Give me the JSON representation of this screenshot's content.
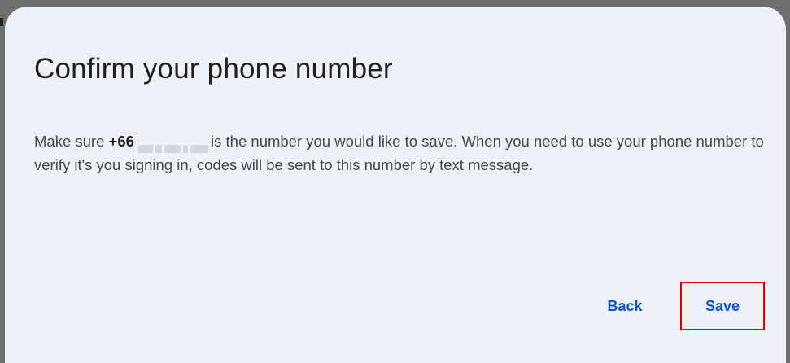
{
  "dialog": {
    "title": "Confirm your phone number",
    "body_prefix": "Make sure ",
    "phone_prefix": "+66",
    "body_suffix": "is the number you would like to save. When you need to use your phone number to verify it's you signing in, codes will be sent to this number by text message.",
    "actions": {
      "back_label": "Back",
      "save_label": "Save"
    }
  },
  "colors": {
    "dialog_bg": "#eef1f8",
    "accent": "#0b57d0",
    "highlight_border": "#e00000"
  }
}
